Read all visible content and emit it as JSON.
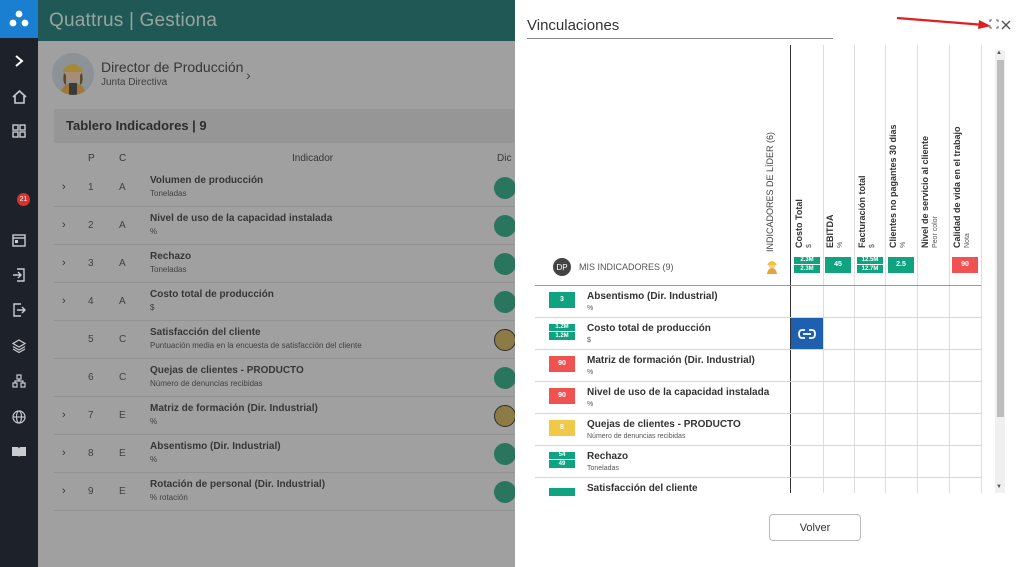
{
  "app": {
    "brand": "Quattrus | Gestiona"
  },
  "sidebar": {
    "badge": "21"
  },
  "profile": {
    "name": "Director de Producción",
    "org": "Junta Directiva",
    "chevron": "›"
  },
  "tablero": {
    "title": "Tablero Indicadores | 9"
  },
  "table": {
    "headers": {
      "p": "P",
      "c": "C",
      "indicador": "Indicador",
      "dic": "Dic"
    },
    "rows": [
      {
        "p": "1",
        "c": "A",
        "name": "Volumen de producción",
        "unit": "Toneladas",
        "status": "green",
        "expand": "›"
      },
      {
        "p": "2",
        "c": "A",
        "name": "Nivel de uso de la capacidad instalada",
        "unit": "%",
        "status": "green",
        "expand": "›"
      },
      {
        "p": "3",
        "c": "A",
        "name": "Rechazo",
        "unit": "Toneladas",
        "status": "green",
        "expand": "›"
      },
      {
        "p": "4",
        "c": "A",
        "name": "Costo total de producción",
        "unit": "$",
        "status": "green",
        "expand": "›"
      },
      {
        "p": "5",
        "c": "C",
        "name": "Satisfacción del cliente",
        "unit": "Puntuación media en la encuesta de satisfacción del cliente",
        "status": "yellow",
        "expand": ""
      },
      {
        "p": "6",
        "c": "C",
        "name": "Quejas de clientes - PRODUCTO",
        "unit": "Número de denuncias recibidas",
        "status": "green",
        "expand": ""
      },
      {
        "p": "7",
        "c": "E",
        "name": "Matriz de formación (Dir. Industrial)",
        "unit": "%",
        "status": "yellow",
        "expand": "›"
      },
      {
        "p": "8",
        "c": "E",
        "name": "Absentismo (Dir. Industrial)",
        "unit": "%",
        "status": "green",
        "expand": "›"
      },
      {
        "p": "9",
        "c": "E",
        "name": "Rotación de personal (Dir. Industrial)",
        "unit": "% rotación",
        "status": "green",
        "expand": "›"
      }
    ]
  },
  "panel": {
    "title": "Vinculaciones",
    "lider_label": "INDICADORES DE LÍDER (6)",
    "dp_initials": "DP",
    "mis_indicadores": "MIS INDICADORES (9)",
    "volver": "Volver",
    "columns": [
      {
        "name": "Costo Total",
        "unit": "$",
        "value_top": "2.3M",
        "value_bottom": "2.3M",
        "color": "green"
      },
      {
        "name": "EBITDA",
        "unit": "%",
        "value_top": "45",
        "value_bottom": "",
        "color": "green"
      },
      {
        "name": "Facturación total",
        "unit": "$",
        "value_top": "12.5M",
        "value_bottom": "12.7M",
        "color": "green"
      },
      {
        "name": "Clientes no pagantes 30 días",
        "unit": "%",
        "value_top": "2.5",
        "value_bottom": "",
        "color": "green"
      },
      {
        "name": "Nivel de servicio al cliente",
        "unit": "Peor color",
        "value_top": "",
        "value_bottom": "",
        "color": ""
      },
      {
        "name": "Calidad de vida en el trabajo",
        "unit": "Nota",
        "value_top": "90",
        "value_bottom": "",
        "color": "red"
      }
    ],
    "rows": [
      {
        "name": "Absentismo (Dir. Industrial)",
        "unit": "%",
        "value_top": "3",
        "value_bottom": "",
        "color": "green"
      },
      {
        "name": "Costo total de producción",
        "unit": "$",
        "value_top": "1.2M",
        "value_bottom": "1.2M",
        "color": "green"
      },
      {
        "name": "Matriz de formación (Dir. Industrial)",
        "unit": "%",
        "value_top": "90",
        "value_bottom": "",
        "color": "red"
      },
      {
        "name": "Nivel de uso de la capacidad instalada",
        "unit": "%",
        "value_top": "90",
        "value_bottom": "",
        "color": "red"
      },
      {
        "name": "Quejas de clientes - PRODUCTO",
        "unit": "Número de denuncias recibidas",
        "value_top": "8",
        "value_bottom": "",
        "color": "yellow"
      },
      {
        "name": "Rechazo",
        "unit": "Toneladas",
        "value_top": "54",
        "value_bottom": "49",
        "color": "green"
      },
      {
        "name": "Satisfacción del cliente",
        "unit": "",
        "value_top": "",
        "value_bottom": "",
        "color": "green"
      }
    ]
  },
  "colors": {
    "primary": "#0c6d66",
    "sidebar": "#1d2129",
    "green": "#10a37f",
    "red": "#f05252",
    "yellow": "#f1c94a",
    "link": "#1f5fb0"
  }
}
